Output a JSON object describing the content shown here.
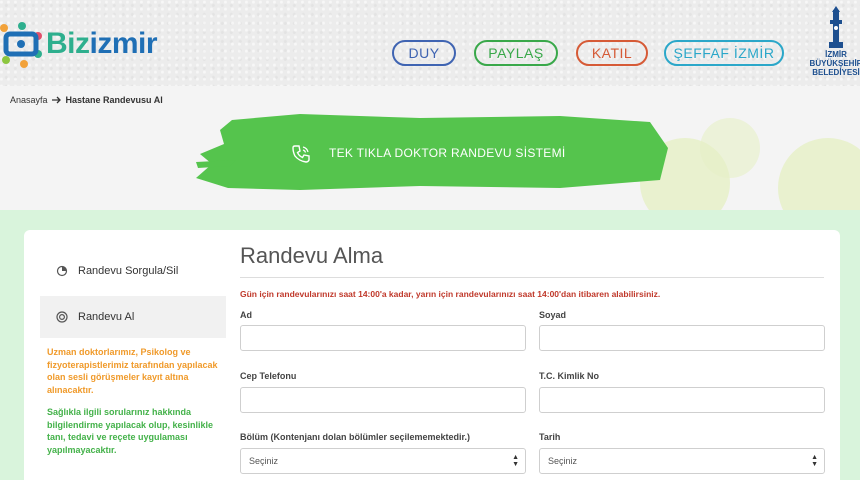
{
  "header": {
    "logo": {
      "prefix": "Biz",
      "suffix": "izmir"
    },
    "nav": [
      {
        "label": "DUY",
        "color": "#3f64b2"
      },
      {
        "label": "PAYLAŞ",
        "color": "#39a84a"
      },
      {
        "label": "KATIL",
        "color": "#d65a36"
      },
      {
        "label": "ŞEFFAF İZMİR",
        "color": "#2ba7c9"
      }
    ],
    "municipality": [
      "İZMİR",
      "BÜYÜKŞEHİR",
      "BELEDİYESİ"
    ]
  },
  "breadcrumb": {
    "home": "Anasayfa",
    "current": "Hastane Randevusu Al"
  },
  "banner": {
    "title": "TEK TIKLA DOKTOR RANDEVU SİSTEMİ",
    "color": "#55c44d",
    "icon": "phone-icon"
  },
  "sidebar": {
    "items": [
      {
        "label": "Randevu Sorgula/Sil",
        "icon": "query-icon"
      },
      {
        "label": "Randevu Al",
        "icon": "target-icon"
      }
    ],
    "note_orange": "Uzman doktorlarımız, Psikolog ve fizyoterapistlerimiz tarafından yapılacak olan sesli görüşmeler kayıt altına alınacaktır.",
    "note_green": "Sağlıkla ilgili sorularınız hakkında bilgilendirme yapılacak olup, kesinlikle tanı, tedavi ve reçete uygulaması yapılmayacaktır."
  },
  "form": {
    "title": "Randevu Alma",
    "warning": "Gün için randevularınızı saat 14:00'a kadar, yarın için randevularınızı saat 14:00'dan itibaren alabilirsiniz.",
    "fields": {
      "ad": {
        "label": "Ad"
      },
      "soyad": {
        "label": "Soyad"
      },
      "cep": {
        "label": "Cep Telefonu"
      },
      "tc": {
        "label": "T.C. Kimlik No"
      },
      "bolum": {
        "label": "Bölüm (Kontenjanı dolan bölümler seçilememektedir.)",
        "value": "Seçiniz"
      },
      "tarih": {
        "label": "Tarih",
        "value": "Seçiniz"
      }
    }
  }
}
